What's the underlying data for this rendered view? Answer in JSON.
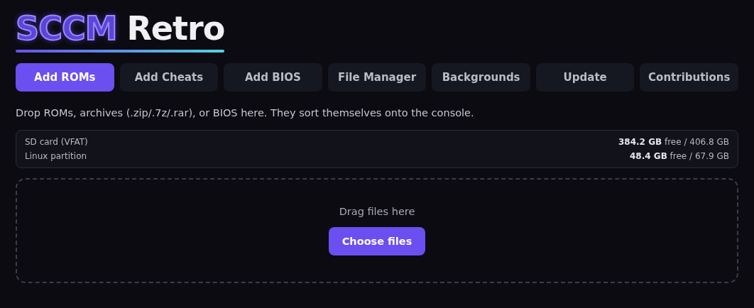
{
  "logo": {
    "accent": "SCCM",
    "text": "Retro"
  },
  "tabs": [
    {
      "label": "Add ROMs",
      "selected": true
    },
    {
      "label": "Add Cheats",
      "selected": false
    },
    {
      "label": "Add BIOS",
      "selected": false
    },
    {
      "label": "File Manager",
      "selected": false
    },
    {
      "label": "Backgrounds",
      "selected": false
    },
    {
      "label": "Update",
      "selected": false
    },
    {
      "label": "Contributions",
      "selected": false
    }
  ],
  "description": "Drop ROMs, archives (.zip/.7z/.rar), or BIOS here. They sort themselves onto the console.",
  "storage": [
    {
      "name": "SD card (VFAT)",
      "usage": "**384.2 GB** free / 406.8 GB"
    },
    {
      "name": "Linux partition",
      "usage": "**48.4 GB** free / 67.9 GB"
    }
  ],
  "dropzone": {
    "hint": "Drag files here",
    "button": "Choose files"
  }
}
